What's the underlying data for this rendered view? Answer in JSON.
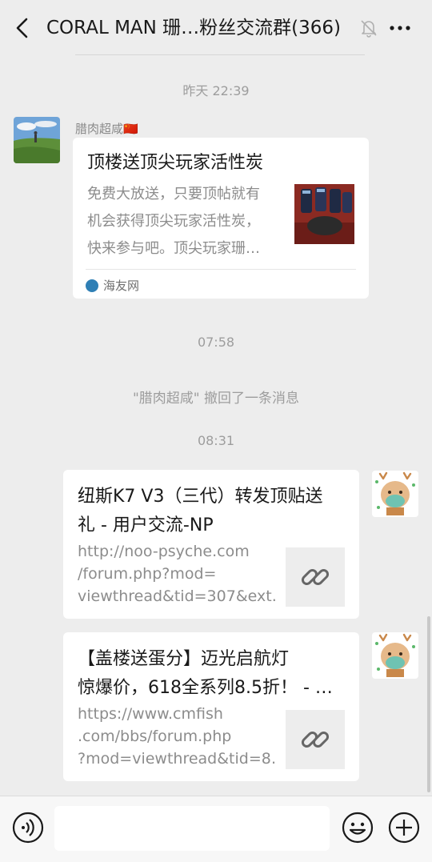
{
  "header": {
    "title": "CORAL MAN 珊…粉丝交流群(366)"
  },
  "messages": {
    "time1": "昨天 22:39",
    "sender1": "腊肉超咸🇨🇳",
    "card1": {
      "title": "顶楼送顶尖玩家活性炭",
      "desc": [
        "免费大放送，只要顶帖就有",
        "机会获得顶尖玩家活性炭，",
        "快来参与吧。顶尖玩家珊…"
      ],
      "source": "海友网"
    },
    "time2": "07:58",
    "recall": "\"腊肉超咸\" 撤回了一条消息",
    "time3": "08:31",
    "card2": {
      "title": [
        "纽斯K7 V3（三代）转发顶贴送",
        "礼 - 用户交流-NP"
      ],
      "url": [
        "http://noo-psyche.com",
        "/forum.php?mod=",
        "viewthread&tid=307&ext…"
      ]
    },
    "card3": {
      "title": [
        "【盖楼送蛋分】迈光启航灯",
        "惊爆价，618全系列8.5折！ - …"
      ],
      "url": [
        "https://www.cmfish",
        ".com/bbs/forum.php",
        "?mod=viewthread&tid=8…"
      ]
    }
  },
  "input": {
    "value": ""
  },
  "icons": {
    "back": "chevron-left-icon",
    "mute": "bell-off-icon",
    "more": "more-icon",
    "voice": "voice-icon",
    "emoji": "emoji-icon",
    "plus": "plus-icon",
    "link": "link-icon"
  },
  "colors": {
    "background": "#ededed",
    "bubble": "#ffffff",
    "source_logo": "#2f7fb5"
  }
}
